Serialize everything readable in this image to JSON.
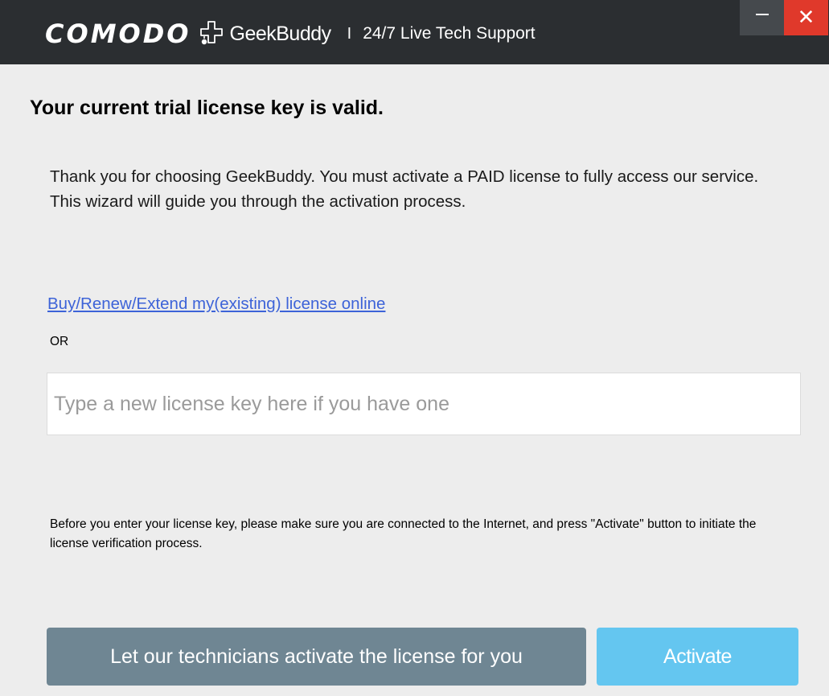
{
  "titlebar": {
    "brand": "COMODO",
    "product": "GeekBuddy",
    "separator": "I",
    "tagline": "24/7 Live Tech Support",
    "close_glyph": "✕",
    "close_color": "#e0392b",
    "background": "#2b2e31"
  },
  "main": {
    "heading": "Your current trial license key is valid.",
    "intro": "Thank you for choosing GeekBuddy. You must activate a PAID license to fully access our service. This wizard will guide you through the activation process.",
    "buy_link": "Buy/Renew/Extend my(existing) license online",
    "or_label": "OR",
    "license_input": {
      "value": "",
      "placeholder": "Type a new license key here if you have one"
    },
    "notice": "Before you enter your license key, please make sure you are connected to the Internet, and press \"Activate\" button to initiate the license verification process."
  },
  "buttons": {
    "technicians_label": "Let our technicians activate the license for you",
    "activate_label": "Activate",
    "activate_color": "#64c6f0",
    "technicians_color": "#6f8693"
  },
  "icons": {
    "logo": "geekbuddy-logo-icon",
    "minimize": "minimize-icon",
    "close": "close-icon"
  }
}
